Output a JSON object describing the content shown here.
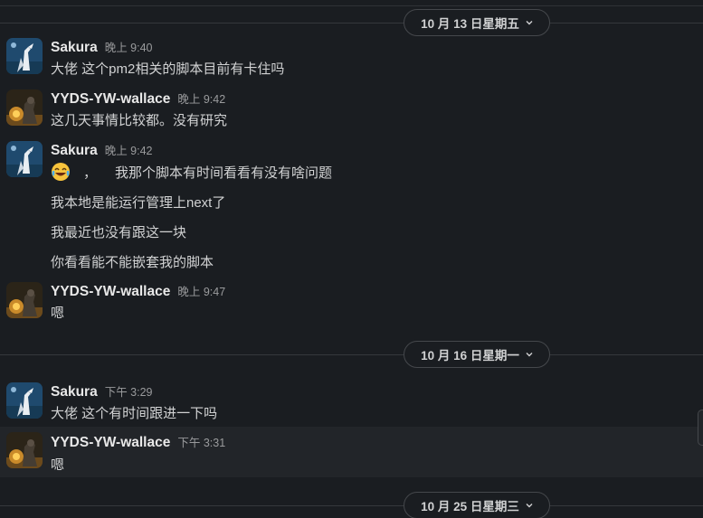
{
  "dividers": [
    {
      "label": "10 月 13 日星期五"
    },
    {
      "label": "10 月 16 日星期一"
    },
    {
      "label": "10 月 25 日星期三"
    }
  ],
  "messages": [
    {
      "author": "Sakura",
      "time": "晚上 9:40",
      "lines": [
        "大佬 这个pm2相关的脚本目前有卡住吗"
      ]
    },
    {
      "author": "YYDS-YW-wallace",
      "time": "晚上 9:42",
      "lines": [
        "这几天事情比较都。没有研究"
      ]
    },
    {
      "author": "Sakura",
      "time": "晚上 9:42",
      "lines": [
        "我那个脚本有时间看看有没有啥问题",
        "我本地是能运行管理上next了",
        "我最近也没有跟这一块",
        "你看看能不能嵌套我的脚本"
      ]
    },
    {
      "author": "YYDS-YW-wallace",
      "time": "晚上 9:47",
      "lines": [
        "嗯"
      ]
    },
    {
      "author": "Sakura",
      "time": "下午 3:29",
      "lines": [
        "大佬 这个有时间跟进一下吗"
      ]
    },
    {
      "author": "YYDS-YW-wallace",
      "time": "下午 3:31",
      "lines": [
        "嗯"
      ]
    }
  ],
  "emoji_prefix": "，",
  "icons": {
    "divider_chevron": "chevron-down-icon",
    "laughing_emoji": "joy-emoji-icon"
  }
}
